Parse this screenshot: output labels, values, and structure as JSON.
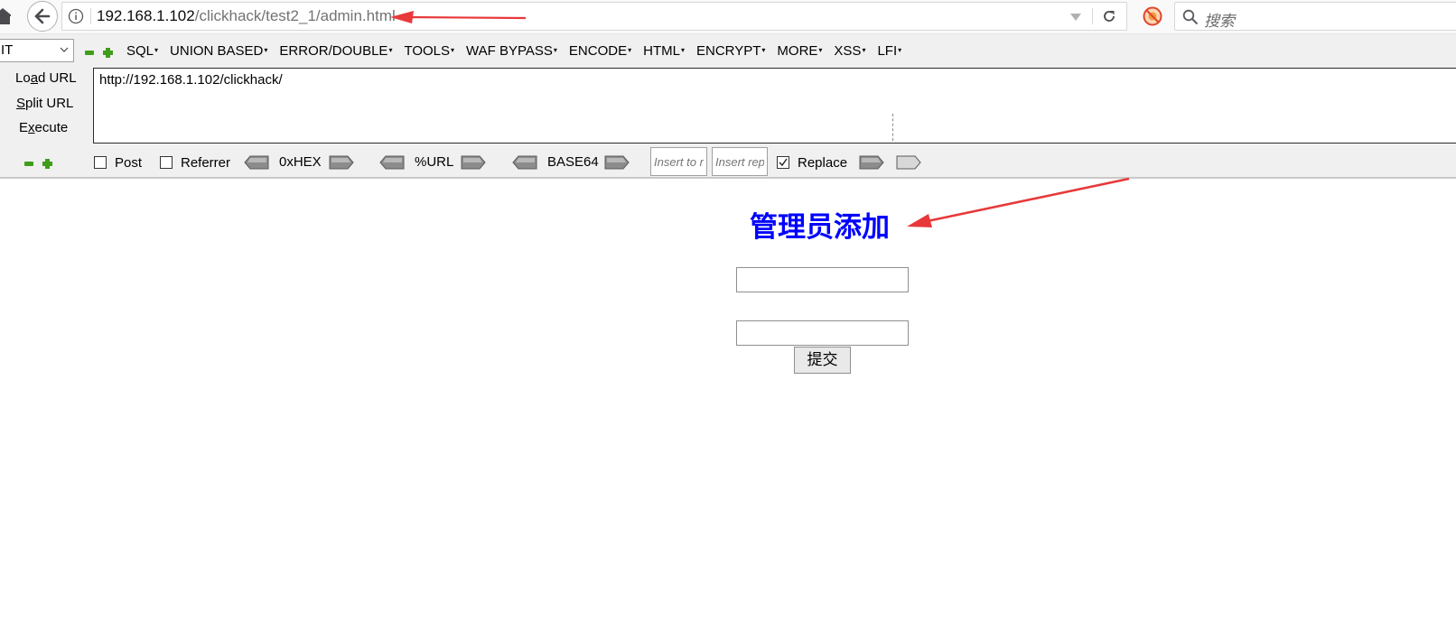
{
  "browser": {
    "url_host": "192.168.1.102",
    "url_path": "/clickhack/test2_1/admin.html",
    "search_placeholder": "搜索"
  },
  "hackbar": {
    "select_value": "IT",
    "menu": [
      {
        "label": "SQL"
      },
      {
        "label": "UNION BASED"
      },
      {
        "label": "ERROR/DOUBLE"
      },
      {
        "label": "TOOLS"
      },
      {
        "label": "WAF BYPASS"
      },
      {
        "label": "ENCODE"
      },
      {
        "label": "HTML"
      },
      {
        "label": "ENCRYPT"
      },
      {
        "label": "MORE"
      },
      {
        "label": "XSS"
      },
      {
        "label": "LFI"
      }
    ],
    "load_url_pre": "Lo",
    "load_url_key": "a",
    "load_url_post": "d URL",
    "split_url_key": "S",
    "split_url_post": "plit URL",
    "execute_pre": "E",
    "execute_key": "x",
    "execute_post": "ecute",
    "url_value": "http://192.168.1.102/clickhack/",
    "post_label": "Post",
    "referrer_label": "Referrer",
    "hex_label": "0xHEX",
    "url_enc_label": "%URL",
    "base64_label": "BASE64",
    "insert_to_placeholder": "Insert to r",
    "insert_rep_placeholder": "Insert rep",
    "replace_label": "Replace",
    "replace_checked": true
  },
  "page": {
    "heading": "管理员添加",
    "submit_label": "提交"
  },
  "colors": {
    "heading": "#0000ff",
    "annotation_arrow": "#e8383a",
    "hackbar_green": "#3e9e1a"
  }
}
